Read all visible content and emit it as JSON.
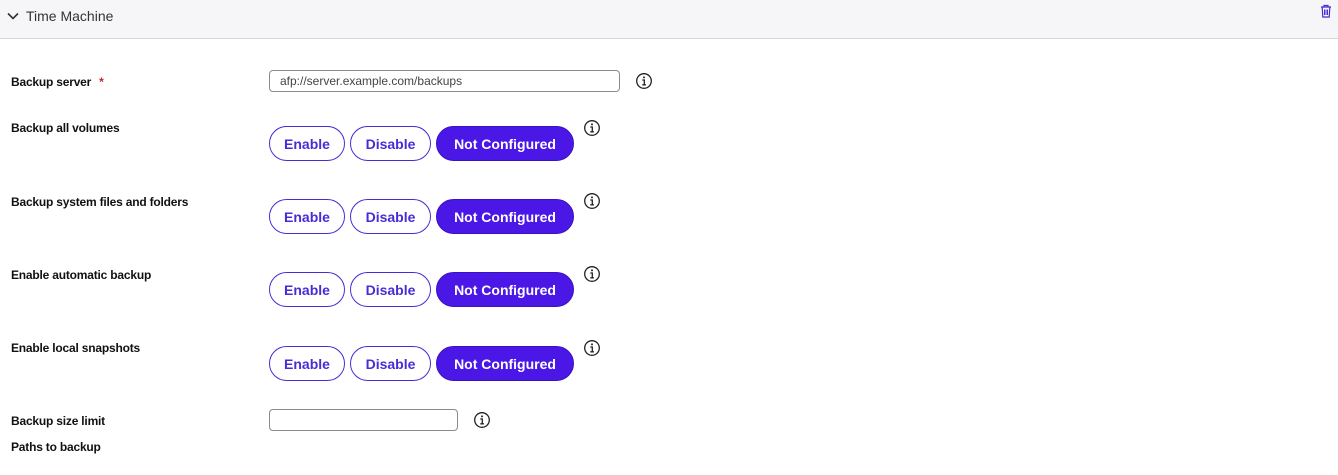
{
  "section": {
    "title": "Time Machine"
  },
  "colors": {
    "accent": "#4a17e6",
    "required": "#c62828"
  },
  "icons": {
    "collapse": "chevron-down-icon",
    "delete": "trash-icon",
    "info": "info-icon"
  },
  "fields": {
    "backup_server": {
      "label": "Backup server",
      "required_mark": "*",
      "value": "afp://server.example.com/backups"
    },
    "backup_size_limit": {
      "label": "Backup size limit",
      "value": ""
    },
    "paths_to_backup": {
      "label": "Paths to backup"
    }
  },
  "toggles": [
    {
      "label": "Backup all volumes",
      "options": [
        "Enable",
        "Disable",
        "Not Configured"
      ],
      "selected": "Not Configured"
    },
    {
      "label": "Backup system files and folders",
      "options": [
        "Enable",
        "Disable",
        "Not Configured"
      ],
      "selected": "Not Configured"
    },
    {
      "label": "Enable automatic backup",
      "options": [
        "Enable",
        "Disable",
        "Not Configured"
      ],
      "selected": "Not Configured"
    },
    {
      "label": "Enable local snapshots",
      "options": [
        "Enable",
        "Disable",
        "Not Configured"
      ],
      "selected": "Not Configured"
    }
  ]
}
